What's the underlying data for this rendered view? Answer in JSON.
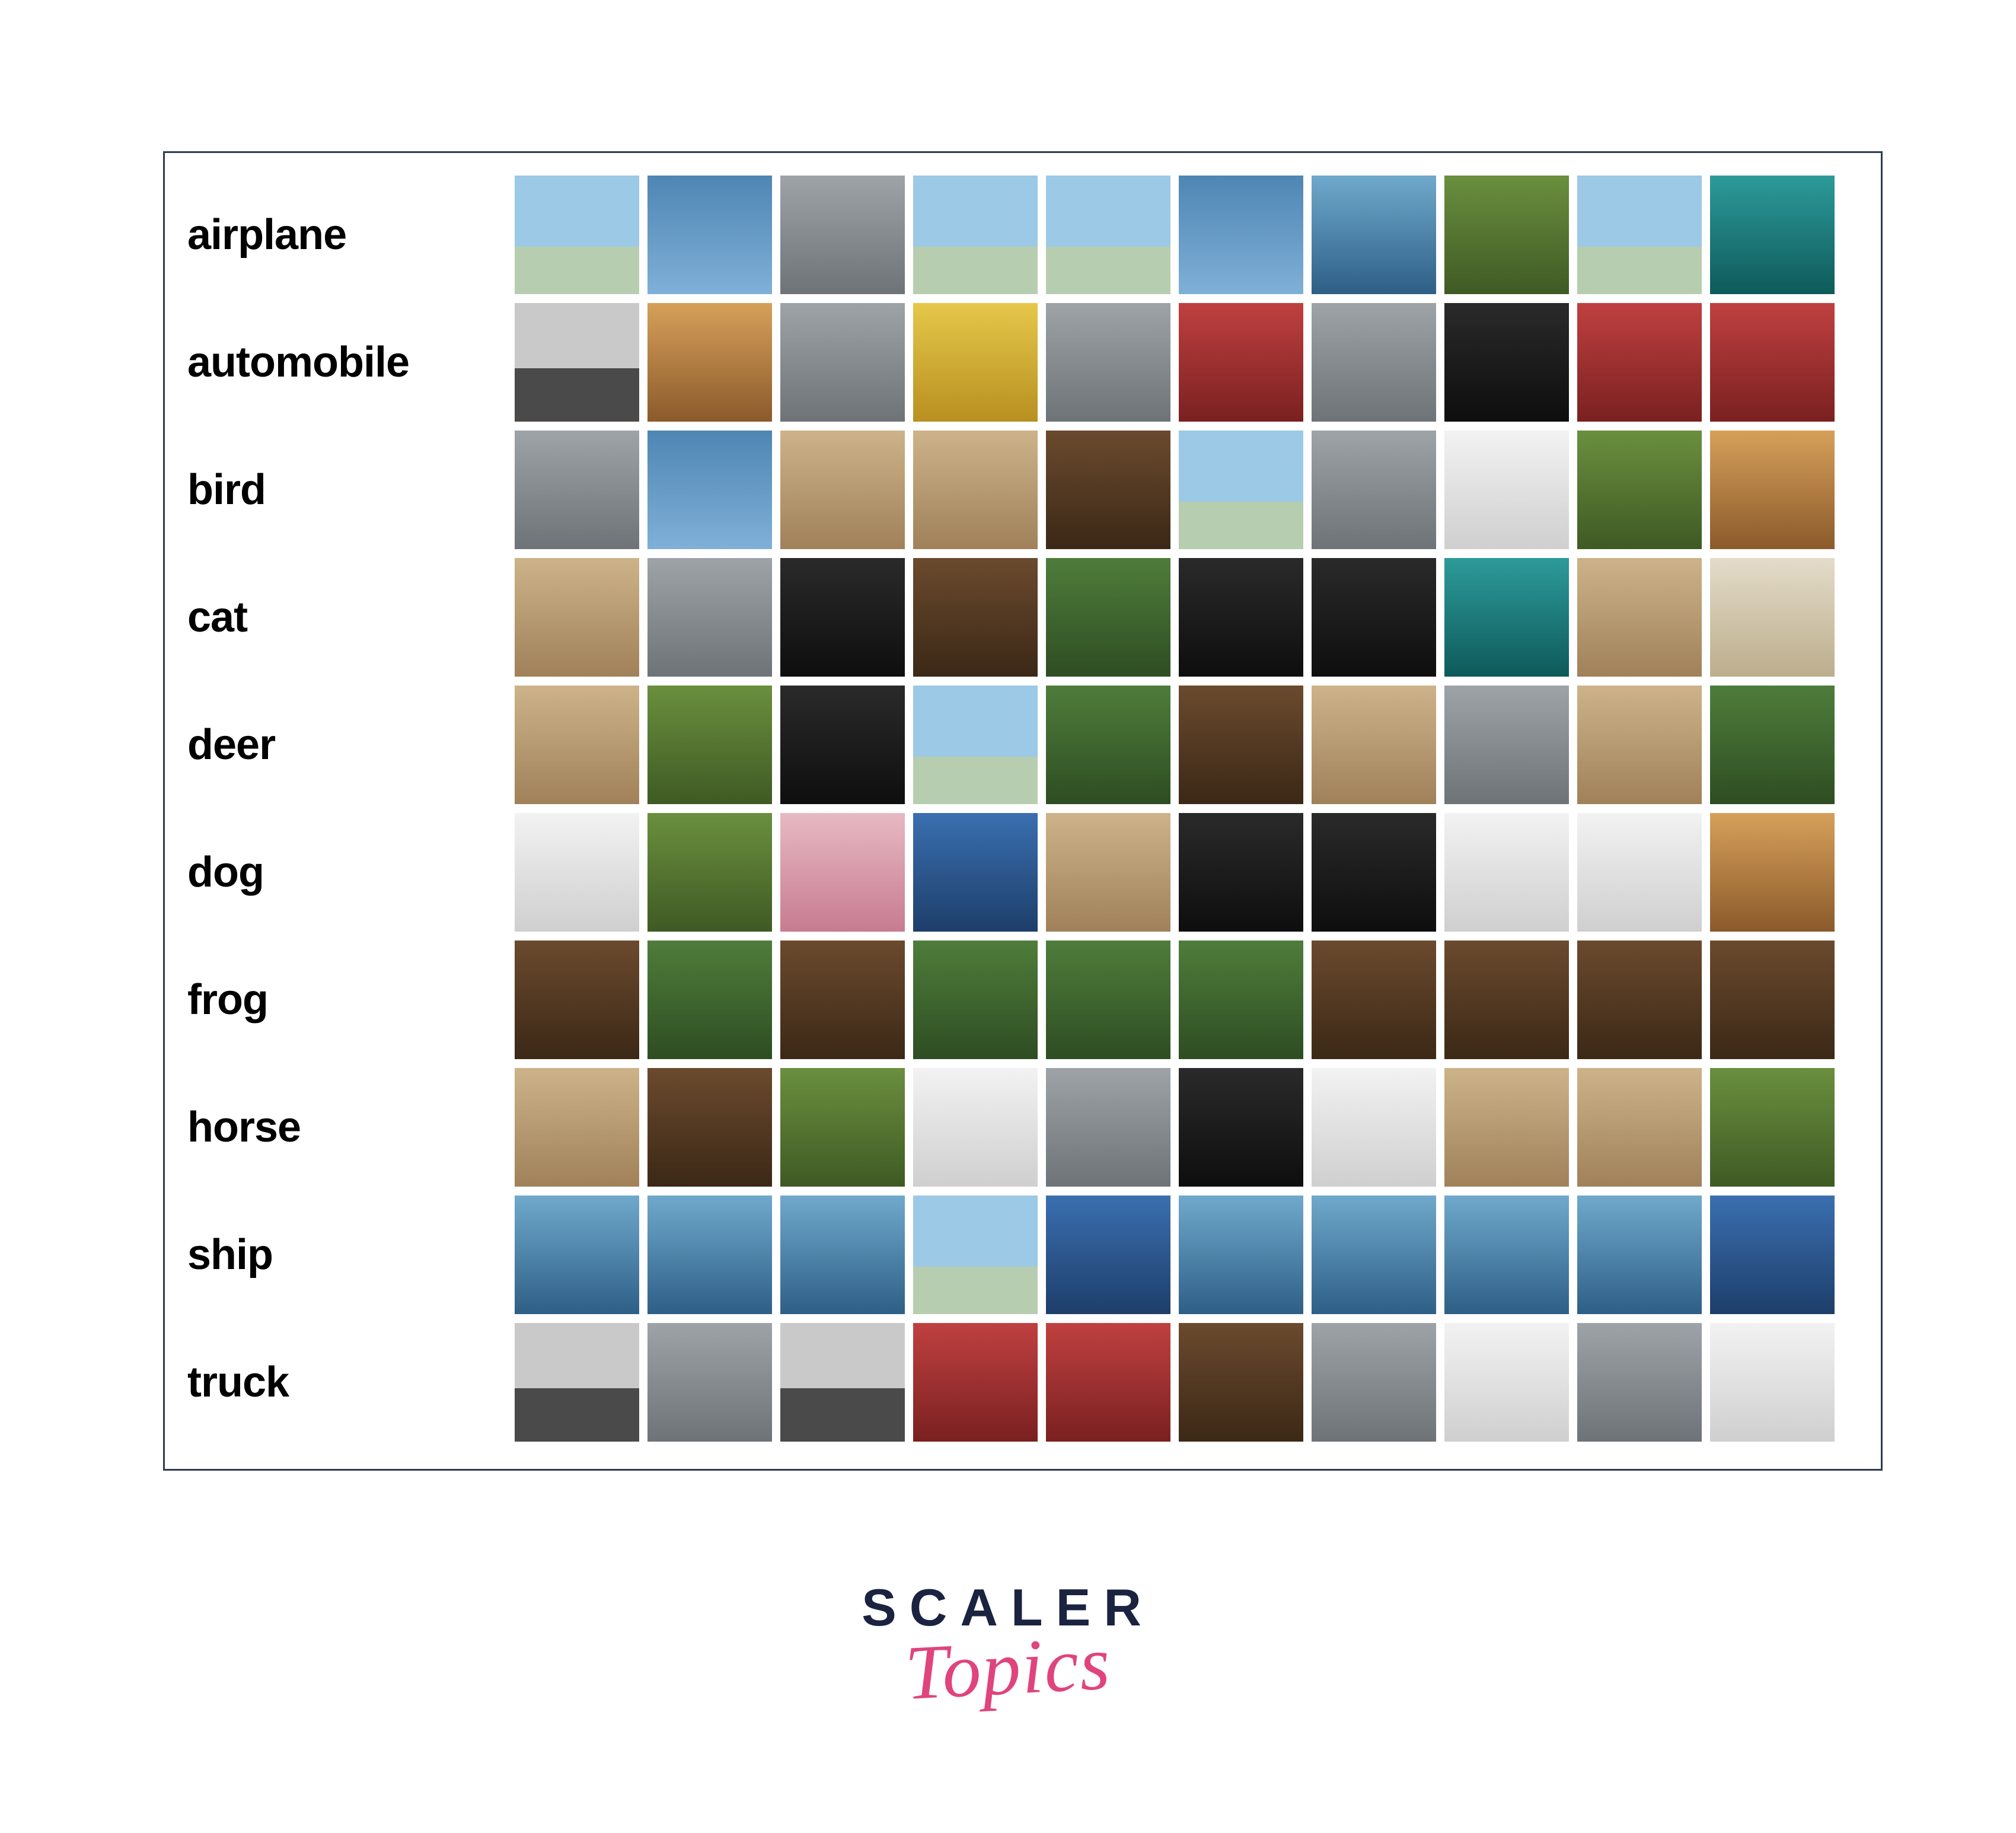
{
  "classes": [
    {
      "label": "airplane",
      "tiles": [
        "t-sky",
        "t-sky2",
        "t-gray",
        "t-sky",
        "t-sky",
        "t-sky2",
        "t-water",
        "t-grass",
        "t-sky",
        "t-teal"
      ]
    },
    {
      "label": "automobile",
      "tiles": [
        "t-road",
        "t-orange",
        "t-gray",
        "t-yellow",
        "t-gray",
        "t-red",
        "t-gray",
        "t-dark",
        "t-red",
        "t-red"
      ]
    },
    {
      "label": "bird",
      "tiles": [
        "t-gray",
        "t-sky2",
        "t-tan",
        "t-tan",
        "t-brown",
        "t-sky",
        "t-gray",
        "t-white",
        "t-grass",
        "t-orange"
      ]
    },
    {
      "label": "cat",
      "tiles": [
        "t-tan",
        "t-gray",
        "t-dark",
        "t-brown",
        "t-green",
        "t-dark",
        "t-dark",
        "t-teal",
        "t-tan",
        "t-beige"
      ]
    },
    {
      "label": "deer",
      "tiles": [
        "t-tan",
        "t-grass",
        "t-dark",
        "t-sky",
        "t-green",
        "t-brown",
        "t-tan",
        "t-gray",
        "t-tan",
        "t-green"
      ]
    },
    {
      "label": "dog",
      "tiles": [
        "t-white",
        "t-grass",
        "t-pink",
        "t-blue",
        "t-tan",
        "t-dark",
        "t-dark",
        "t-white",
        "t-white",
        "t-orange"
      ]
    },
    {
      "label": "frog",
      "tiles": [
        "t-brown",
        "t-green",
        "t-brown",
        "t-green",
        "t-green",
        "t-green",
        "t-brown",
        "t-brown",
        "t-brown",
        "t-brown"
      ]
    },
    {
      "label": "horse",
      "tiles": [
        "t-tan",
        "t-brown",
        "t-grass",
        "t-white",
        "t-gray",
        "t-dark",
        "t-white",
        "t-tan",
        "t-tan",
        "t-grass"
      ]
    },
    {
      "label": "ship",
      "tiles": [
        "t-water",
        "t-water",
        "t-water",
        "t-sky",
        "t-blue",
        "t-water",
        "t-water",
        "t-water",
        "t-water",
        "t-blue"
      ]
    },
    {
      "label": "truck",
      "tiles": [
        "t-road",
        "t-gray",
        "t-road",
        "t-red",
        "t-red",
        "t-brown",
        "t-gray",
        "t-white",
        "t-gray",
        "t-white"
      ]
    }
  ],
  "logo": {
    "line1": "SCALER",
    "line2": "Topics"
  }
}
